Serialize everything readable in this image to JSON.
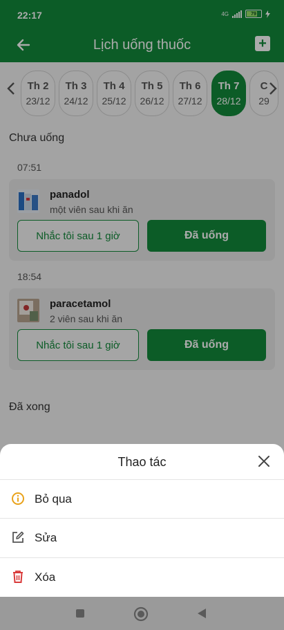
{
  "status": {
    "time": "22:17",
    "network": "4G",
    "battery": "79"
  },
  "header": {
    "title": "Lịch uống thuốc"
  },
  "days": [
    {
      "name": "Th 2",
      "date": "23/12"
    },
    {
      "name": "Th 3",
      "date": "24/12"
    },
    {
      "name": "Th 4",
      "date": "25/12"
    },
    {
      "name": "Th 5",
      "date": "26/12"
    },
    {
      "name": "Th 6",
      "date": "27/12"
    },
    {
      "name": "Th 7",
      "date": "28/12"
    },
    {
      "name": "C",
      "date": "29"
    }
  ],
  "sections": {
    "pending": "Chưa uống",
    "done": "Đã xong"
  },
  "meds": [
    {
      "time": "07:51",
      "name": "panadol",
      "note": "một viên sau khi ăn",
      "remind_label": "Nhắc tôi sau 1 giờ",
      "taken_label": "Đã uống"
    },
    {
      "time": "18:54",
      "name": "paracetamol",
      "note": "2 viên sau khi ăn",
      "remind_label": "Nhắc tôi sau 1 giờ",
      "taken_label": "Đã uống"
    }
  ],
  "sheet": {
    "title": "Thao tác",
    "actions": [
      {
        "label": "Bỏ qua",
        "icon": "info-icon",
        "color": "#e9a21a"
      },
      {
        "label": "Sửa",
        "icon": "edit-icon",
        "color": "#555555"
      },
      {
        "label": "Xóa",
        "icon": "trash-icon",
        "color": "#d93a3a"
      }
    ]
  },
  "colors": {
    "primary": "#138a3b"
  }
}
